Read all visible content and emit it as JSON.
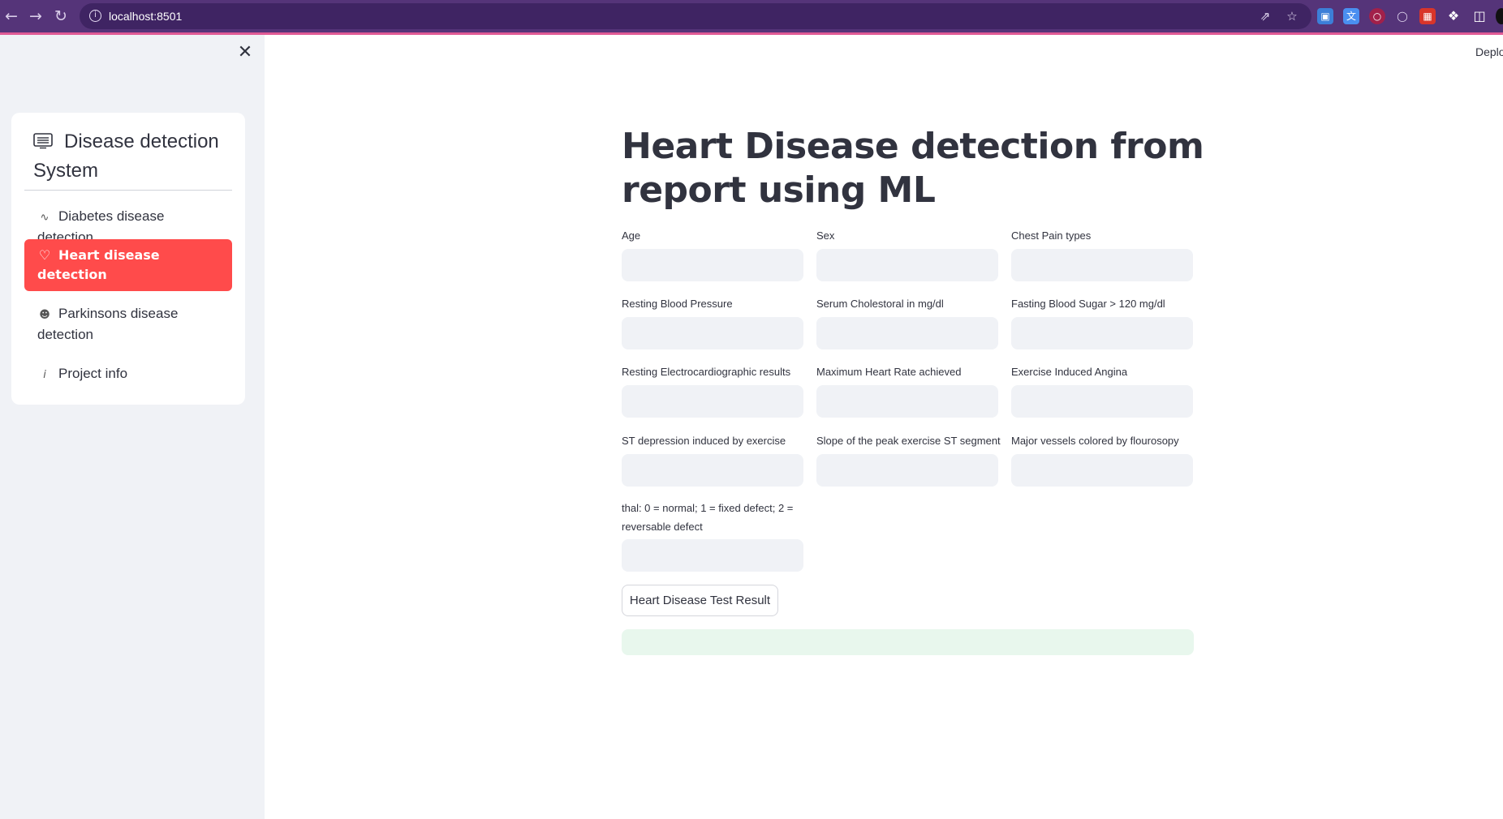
{
  "browser": {
    "url": "localhost:8501"
  },
  "sidebar": {
    "title": "Disease detection System",
    "items": [
      {
        "label": "Diabetes disease detection",
        "icon": "activity-icon",
        "active": false
      },
      {
        "label": "Heart disease detection",
        "icon": "heart-icon",
        "active": true
      },
      {
        "label": "Parkinsons disease detection",
        "icon": "person-icon",
        "active": false
      },
      {
        "label": "Project info",
        "icon": "info-icon",
        "active": false
      }
    ]
  },
  "header": {
    "deploy_label": "Deploy"
  },
  "main": {
    "title": "Heart Disease detection from report using ML",
    "fields": [
      {
        "label": "Age",
        "value": ""
      },
      {
        "label": "Sex",
        "value": ""
      },
      {
        "label": "Chest Pain types",
        "value": ""
      },
      {
        "label": "Resting Blood Pressure",
        "value": ""
      },
      {
        "label": "Serum Cholestoral in mg/dl",
        "value": ""
      },
      {
        "label": "Fasting Blood Sugar > 120 mg/dl",
        "value": ""
      },
      {
        "label": "Resting Electrocardiographic results",
        "value": ""
      },
      {
        "label": "Maximum Heart Rate achieved",
        "value": ""
      },
      {
        "label": "Exercise Induced Angina",
        "value": ""
      },
      {
        "label": "ST depression induced by exercise",
        "value": ""
      },
      {
        "label": "Slope of the peak exercise ST segment",
        "value": ""
      },
      {
        "label": "Major vessels colored by flourosopy",
        "value": ""
      },
      {
        "label": "thal: 0 = normal; 1 = fixed defect; 2 = reversable defect",
        "value": ""
      }
    ],
    "submit_label": "Heart Disease Test Result",
    "result_text": ""
  },
  "colors": {
    "accent": "#ff4b4b",
    "browser_frame": "#553479",
    "sidebar_bg": "#f0f2f6",
    "input_bg": "#f0f2f6",
    "success_bg": "#e8f7ed"
  }
}
